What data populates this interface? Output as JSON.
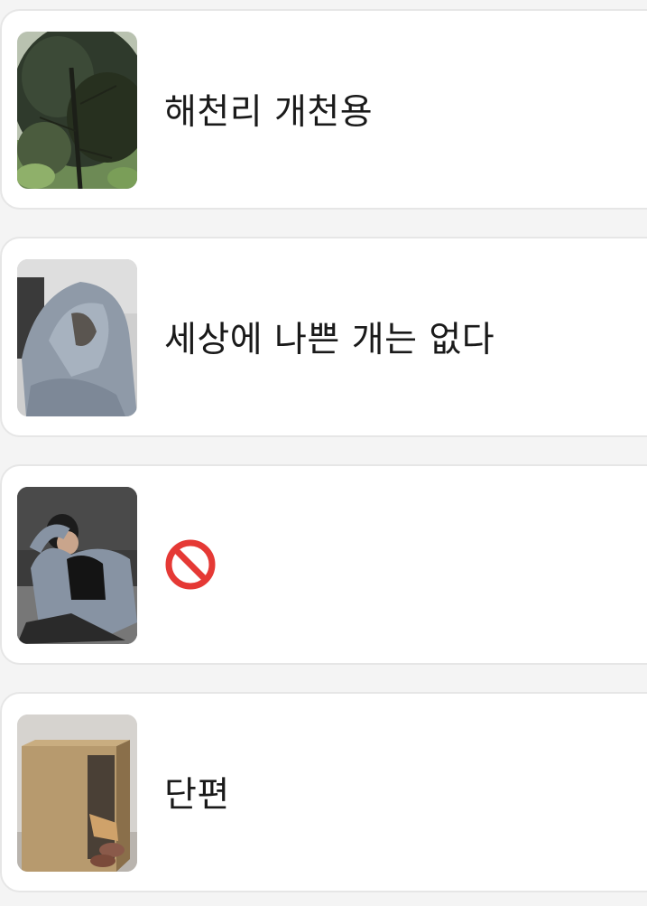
{
  "items": [
    {
      "title": "해천리 개천용",
      "thumb_icon": "tree-photo-thumbnail"
    },
    {
      "title": "세상에 나쁜 개는 없다",
      "thumb_icon": "hooded-person-photo-thumbnail"
    },
    {
      "title": "",
      "thumb_icon": "reclining-person-photo-thumbnail",
      "title_icon": "prohibited-icon"
    },
    {
      "title": "단편",
      "thumb_icon": "person-in-box-photo-thumbnail"
    }
  ],
  "colors": {
    "card_background": "#ffffff",
    "card_border": "#e6e6e6",
    "page_background": "#f4f4f4",
    "title_text": "#1a1a1a",
    "prohibited_red": "#e53935"
  }
}
